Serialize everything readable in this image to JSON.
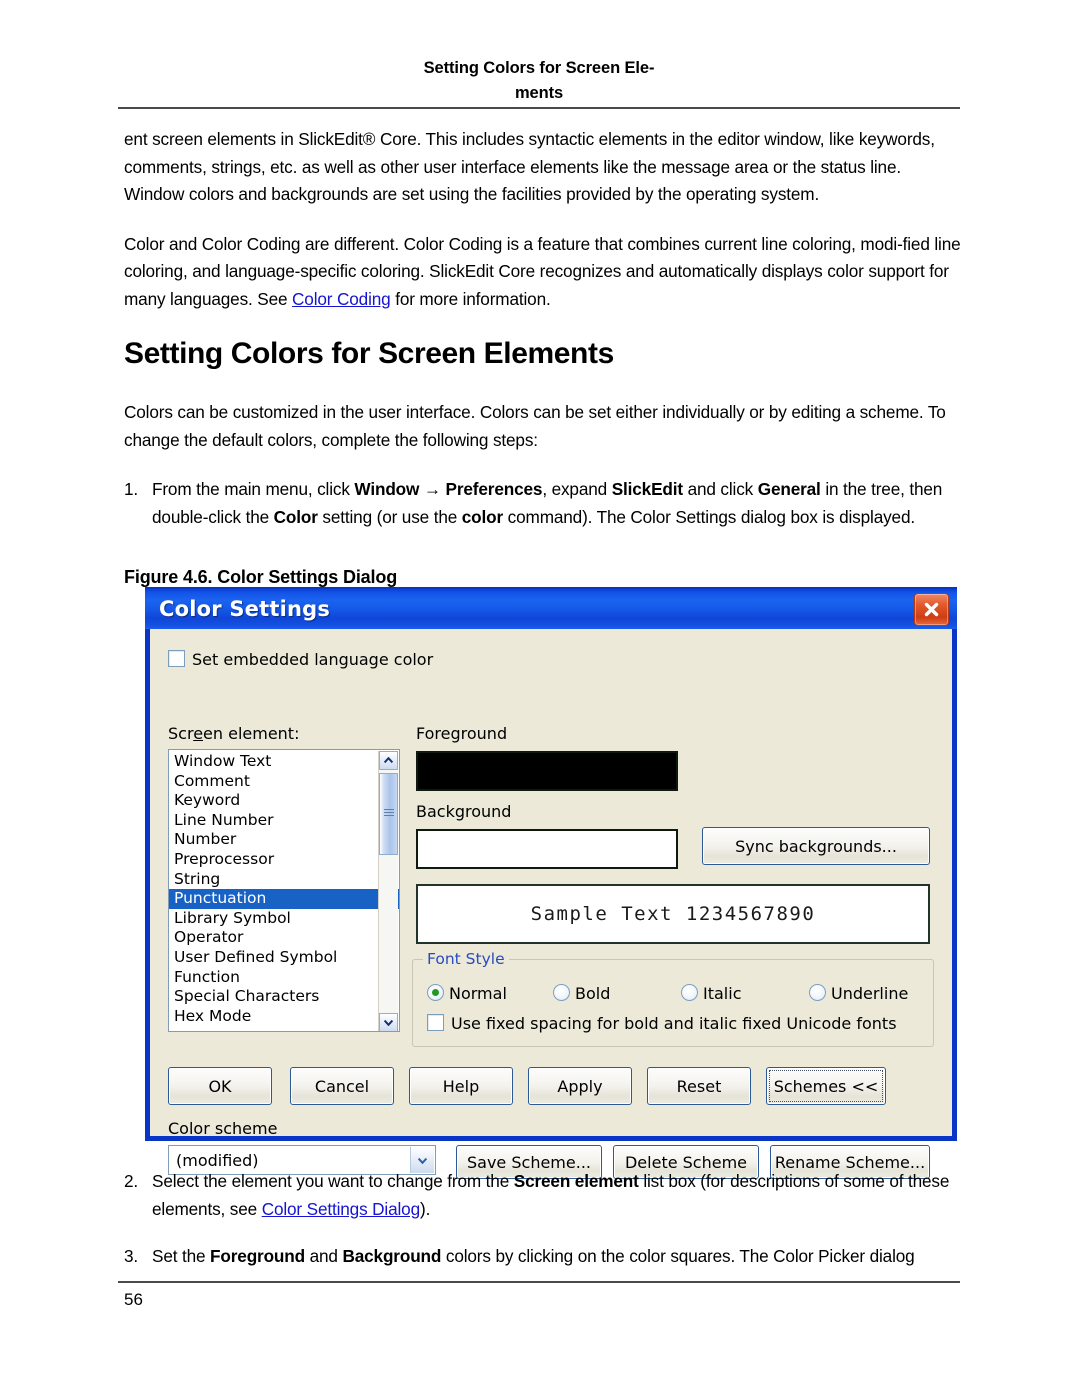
{
  "page": {
    "running_header_line1": "Setting Colors for Screen Ele-",
    "running_header_line2": "ments",
    "page_number": "56"
  },
  "intro": {
    "para1": "ent screen elements in SlickEdit® Core. This includes syntactic elements in the editor window, like keywords, comments, strings, etc. as well as other user interface elements like the message area or the status line. Window colors and backgrounds are set using the facilities provided by the operating system.",
    "para2_before_link": "Color and Color Coding are different. Color Coding is a feature that combines current line coloring, modi-fied line coloring, and language-specific coloring. SlickEdit Core recognizes and automatically displays color support for many languages. See ",
    "para2_link": "Color Coding",
    "para2_after_link": " for more information."
  },
  "section": {
    "heading": "Setting Colors for Screen Elements",
    "intro": "Colors can be customized in the user interface. Colors can be set either individually or by editing a scheme. To change the default colors, complete the following steps:"
  },
  "steps": {
    "step1": {
      "num": "1.",
      "t1": "From the main menu, click ",
      "b1": "Window",
      "t2": " → ",
      "b2": "Preferences",
      "t3": ", expand ",
      "b3": "SlickEdit",
      "t4": " and click ",
      "b4": "General",
      "t5": " in the tree, then double-click the ",
      "b5": "Color",
      "t6": " setting (or use the ",
      "b6": "color",
      "t7": " command). The Color Settings dialog box is displayed."
    },
    "step2": {
      "num": "2.",
      "t1": "Select the element you want to change from the ",
      "b1": "Screen element",
      "t2": " list box (for descriptions of some of these elements, see ",
      "link": "Color Settings Dialog",
      "t3": ")."
    },
    "step3": {
      "num": "3.",
      "t1": "Set the ",
      "b1": "Foreground",
      "t2": " and ",
      "b2": "Background",
      "t3": " colors by clicking on the color squares. The Color Picker dialog"
    }
  },
  "figure": {
    "caption": "Figure 4.6.  Color Settings Dialog"
  },
  "dialog": {
    "title": "Color Settings",
    "close_icon": "close-icon",
    "embedded_checkbox_label": "Set embedded language color",
    "screen_element_label_pre": "Scr",
    "screen_element_label_accel": "e",
    "screen_element_label_post": "en element:",
    "screen_elements": [
      "Window Text",
      "Comment",
      "Keyword",
      "Line Number",
      "Number",
      "Preprocessor",
      "String",
      "Punctuation",
      "Library Symbol",
      "Operator",
      "User Defined Symbol",
      "Function",
      "Special Characters",
      "Hex Mode"
    ],
    "selected_element": "Punctuation",
    "foreground_label": "Foreground",
    "foreground_color": "#000000",
    "background_label": "Background",
    "background_color": "#ffffff",
    "sync_button": "Sync backgrounds...",
    "sample_text": "Sample Text 1234567890",
    "font_style": {
      "group_label": "Font Style",
      "options": [
        "Normal",
        "Bold",
        "Italic",
        "Underline"
      ],
      "selected": "Normal",
      "fixed_spacing_label": "Use fixed spacing for bold and italic fixed Unicode fonts",
      "fixed_spacing_checked": false
    },
    "buttons": {
      "ok": "OK",
      "cancel": "Cancel",
      "help": "Help",
      "apply": "Apply",
      "reset": "Reset",
      "schemes": "Schemes <<"
    },
    "color_scheme_label": "Color scheme",
    "color_scheme_value": "(modified)",
    "scheme_buttons": {
      "save": "Save Scheme...",
      "delete": "Delete Scheme",
      "rename": "Rename Scheme..."
    },
    "colors": {
      "titlebar_blue": "#1458e8",
      "dialog_face": "#ece9d8",
      "selection_blue": "#1762c4",
      "group_label_blue": "#2a4bbf",
      "close_red": "#cf3c14",
      "radio_green": "#1f9b1f"
    }
  }
}
